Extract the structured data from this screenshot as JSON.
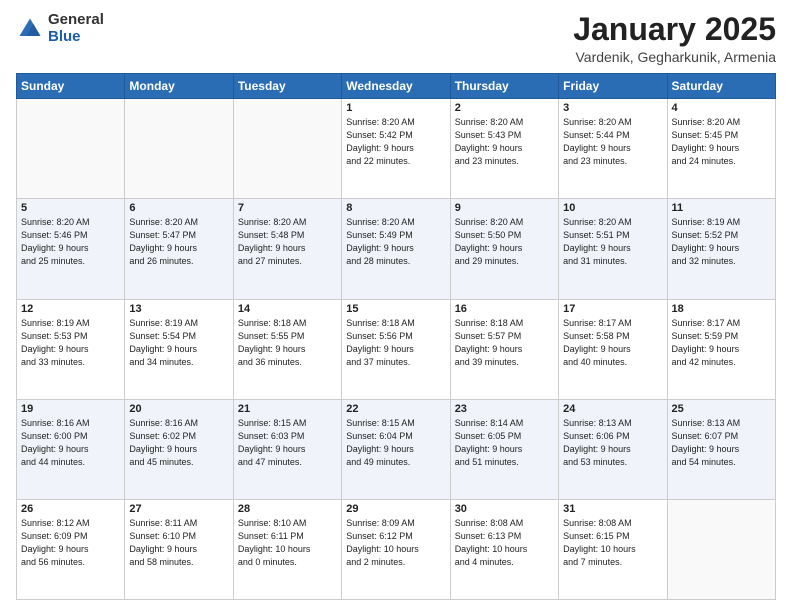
{
  "logo": {
    "general": "General",
    "blue": "Blue"
  },
  "title": "January 2025",
  "location": "Vardenik, Gegharkunik, Armenia",
  "days_header": [
    "Sunday",
    "Monday",
    "Tuesday",
    "Wednesday",
    "Thursday",
    "Friday",
    "Saturday"
  ],
  "weeks": [
    [
      {
        "day": "",
        "info": ""
      },
      {
        "day": "",
        "info": ""
      },
      {
        "day": "",
        "info": ""
      },
      {
        "day": "1",
        "info": "Sunrise: 8:20 AM\nSunset: 5:42 PM\nDaylight: 9 hours\nand 22 minutes."
      },
      {
        "day": "2",
        "info": "Sunrise: 8:20 AM\nSunset: 5:43 PM\nDaylight: 9 hours\nand 23 minutes."
      },
      {
        "day": "3",
        "info": "Sunrise: 8:20 AM\nSunset: 5:44 PM\nDaylight: 9 hours\nand 23 minutes."
      },
      {
        "day": "4",
        "info": "Sunrise: 8:20 AM\nSunset: 5:45 PM\nDaylight: 9 hours\nand 24 minutes."
      }
    ],
    [
      {
        "day": "5",
        "info": "Sunrise: 8:20 AM\nSunset: 5:46 PM\nDaylight: 9 hours\nand 25 minutes."
      },
      {
        "day": "6",
        "info": "Sunrise: 8:20 AM\nSunset: 5:47 PM\nDaylight: 9 hours\nand 26 minutes."
      },
      {
        "day": "7",
        "info": "Sunrise: 8:20 AM\nSunset: 5:48 PM\nDaylight: 9 hours\nand 27 minutes."
      },
      {
        "day": "8",
        "info": "Sunrise: 8:20 AM\nSunset: 5:49 PM\nDaylight: 9 hours\nand 28 minutes."
      },
      {
        "day": "9",
        "info": "Sunrise: 8:20 AM\nSunset: 5:50 PM\nDaylight: 9 hours\nand 29 minutes."
      },
      {
        "day": "10",
        "info": "Sunrise: 8:20 AM\nSunset: 5:51 PM\nDaylight: 9 hours\nand 31 minutes."
      },
      {
        "day": "11",
        "info": "Sunrise: 8:19 AM\nSunset: 5:52 PM\nDaylight: 9 hours\nand 32 minutes."
      }
    ],
    [
      {
        "day": "12",
        "info": "Sunrise: 8:19 AM\nSunset: 5:53 PM\nDaylight: 9 hours\nand 33 minutes."
      },
      {
        "day": "13",
        "info": "Sunrise: 8:19 AM\nSunset: 5:54 PM\nDaylight: 9 hours\nand 34 minutes."
      },
      {
        "day": "14",
        "info": "Sunrise: 8:18 AM\nSunset: 5:55 PM\nDaylight: 9 hours\nand 36 minutes."
      },
      {
        "day": "15",
        "info": "Sunrise: 8:18 AM\nSunset: 5:56 PM\nDaylight: 9 hours\nand 37 minutes."
      },
      {
        "day": "16",
        "info": "Sunrise: 8:18 AM\nSunset: 5:57 PM\nDaylight: 9 hours\nand 39 minutes."
      },
      {
        "day": "17",
        "info": "Sunrise: 8:17 AM\nSunset: 5:58 PM\nDaylight: 9 hours\nand 40 minutes."
      },
      {
        "day": "18",
        "info": "Sunrise: 8:17 AM\nSunset: 5:59 PM\nDaylight: 9 hours\nand 42 minutes."
      }
    ],
    [
      {
        "day": "19",
        "info": "Sunrise: 8:16 AM\nSunset: 6:00 PM\nDaylight: 9 hours\nand 44 minutes."
      },
      {
        "day": "20",
        "info": "Sunrise: 8:16 AM\nSunset: 6:02 PM\nDaylight: 9 hours\nand 45 minutes."
      },
      {
        "day": "21",
        "info": "Sunrise: 8:15 AM\nSunset: 6:03 PM\nDaylight: 9 hours\nand 47 minutes."
      },
      {
        "day": "22",
        "info": "Sunrise: 8:15 AM\nSunset: 6:04 PM\nDaylight: 9 hours\nand 49 minutes."
      },
      {
        "day": "23",
        "info": "Sunrise: 8:14 AM\nSunset: 6:05 PM\nDaylight: 9 hours\nand 51 minutes."
      },
      {
        "day": "24",
        "info": "Sunrise: 8:13 AM\nSunset: 6:06 PM\nDaylight: 9 hours\nand 53 minutes."
      },
      {
        "day": "25",
        "info": "Sunrise: 8:13 AM\nSunset: 6:07 PM\nDaylight: 9 hours\nand 54 minutes."
      }
    ],
    [
      {
        "day": "26",
        "info": "Sunrise: 8:12 AM\nSunset: 6:09 PM\nDaylight: 9 hours\nand 56 minutes."
      },
      {
        "day": "27",
        "info": "Sunrise: 8:11 AM\nSunset: 6:10 PM\nDaylight: 9 hours\nand 58 minutes."
      },
      {
        "day": "28",
        "info": "Sunrise: 8:10 AM\nSunset: 6:11 PM\nDaylight: 10 hours\nand 0 minutes."
      },
      {
        "day": "29",
        "info": "Sunrise: 8:09 AM\nSunset: 6:12 PM\nDaylight: 10 hours\nand 2 minutes."
      },
      {
        "day": "30",
        "info": "Sunrise: 8:08 AM\nSunset: 6:13 PM\nDaylight: 10 hours\nand 4 minutes."
      },
      {
        "day": "31",
        "info": "Sunrise: 8:08 AM\nSunset: 6:15 PM\nDaylight: 10 hours\nand 7 minutes."
      },
      {
        "day": "",
        "info": ""
      }
    ]
  ]
}
